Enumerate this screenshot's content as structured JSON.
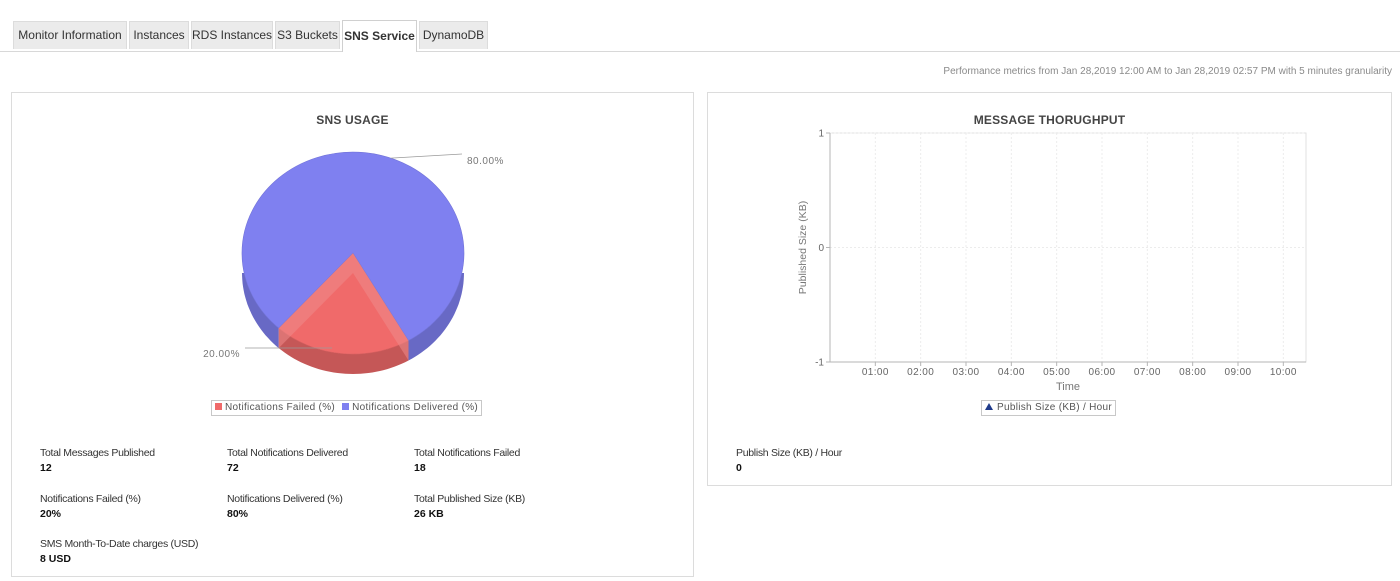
{
  "tabs": [
    {
      "label": "Monitor Information",
      "active": false
    },
    {
      "label": "Instances",
      "active": false
    },
    {
      "label": "RDS Instances",
      "active": false
    },
    {
      "label": "S3 Buckets",
      "active": false
    },
    {
      "label": "SNS Service",
      "active": true
    },
    {
      "label": "DynamoDB",
      "active": false
    }
  ],
  "perf_note": "Performance metrics from Jan 28,2019 12:00 AM to Jan 28,2019 02:57 PM with 5 minutes granularity",
  "sns_panel": {
    "title": "SNS USAGE",
    "legend": [
      {
        "label": "Notifications Failed (%)",
        "color": "#f06a6a"
      },
      {
        "label": "Notifications Delivered (%)",
        "color": "#7f80f0"
      }
    ],
    "stats": [
      {
        "label": "Total Messages Published",
        "value": "12"
      },
      {
        "label": "Total Notifications Delivered",
        "value": "72"
      },
      {
        "label": "Total Notifications Failed",
        "value": "18"
      },
      {
        "label": "Notifications Failed (%)",
        "value": "20%"
      },
      {
        "label": "Notifications Delivered (%)",
        "value": "80%"
      },
      {
        "label": "Total Published Size (KB)",
        "value": "26 KB"
      },
      {
        "label": "SMS Month-To-Date charges (USD)",
        "value": "8 USD"
      }
    ]
  },
  "msg_panel": {
    "title": "MESSAGE THORUGHPUT",
    "legend": "Publish Size (KB) / Hour",
    "stat": {
      "label": "Publish Size (KB) / Hour",
      "value": "0"
    }
  },
  "chart_data": [
    {
      "type": "pie",
      "title": "SNS USAGE",
      "categories": [
        "Notifications Failed (%)",
        "Notifications Delivered (%)"
      ],
      "values": [
        20,
        80
      ],
      "labels": [
        "20.00%",
        "80.00%"
      ],
      "colors": [
        "#f06a6a",
        "#7f80f0"
      ],
      "style": "3d"
    },
    {
      "type": "area",
      "title": "MESSAGE THORUGHPUT",
      "xlabel": "Time",
      "ylabel": "Published Size (KB)",
      "x": [
        "01:00",
        "02:00",
        "03:00",
        "04:00",
        "05:00",
        "06:00",
        "07:00",
        "08:00",
        "09:00",
        "10:00"
      ],
      "yticks": [
        "1",
        "0",
        "-1"
      ],
      "ylim": [
        -1,
        1
      ],
      "grid": true,
      "series": [
        {
          "name": "Publish Size (KB) / Hour",
          "values": [
            0,
            0,
            0,
            0,
            0,
            0,
            0,
            0,
            0,
            0
          ]
        }
      ]
    }
  ]
}
